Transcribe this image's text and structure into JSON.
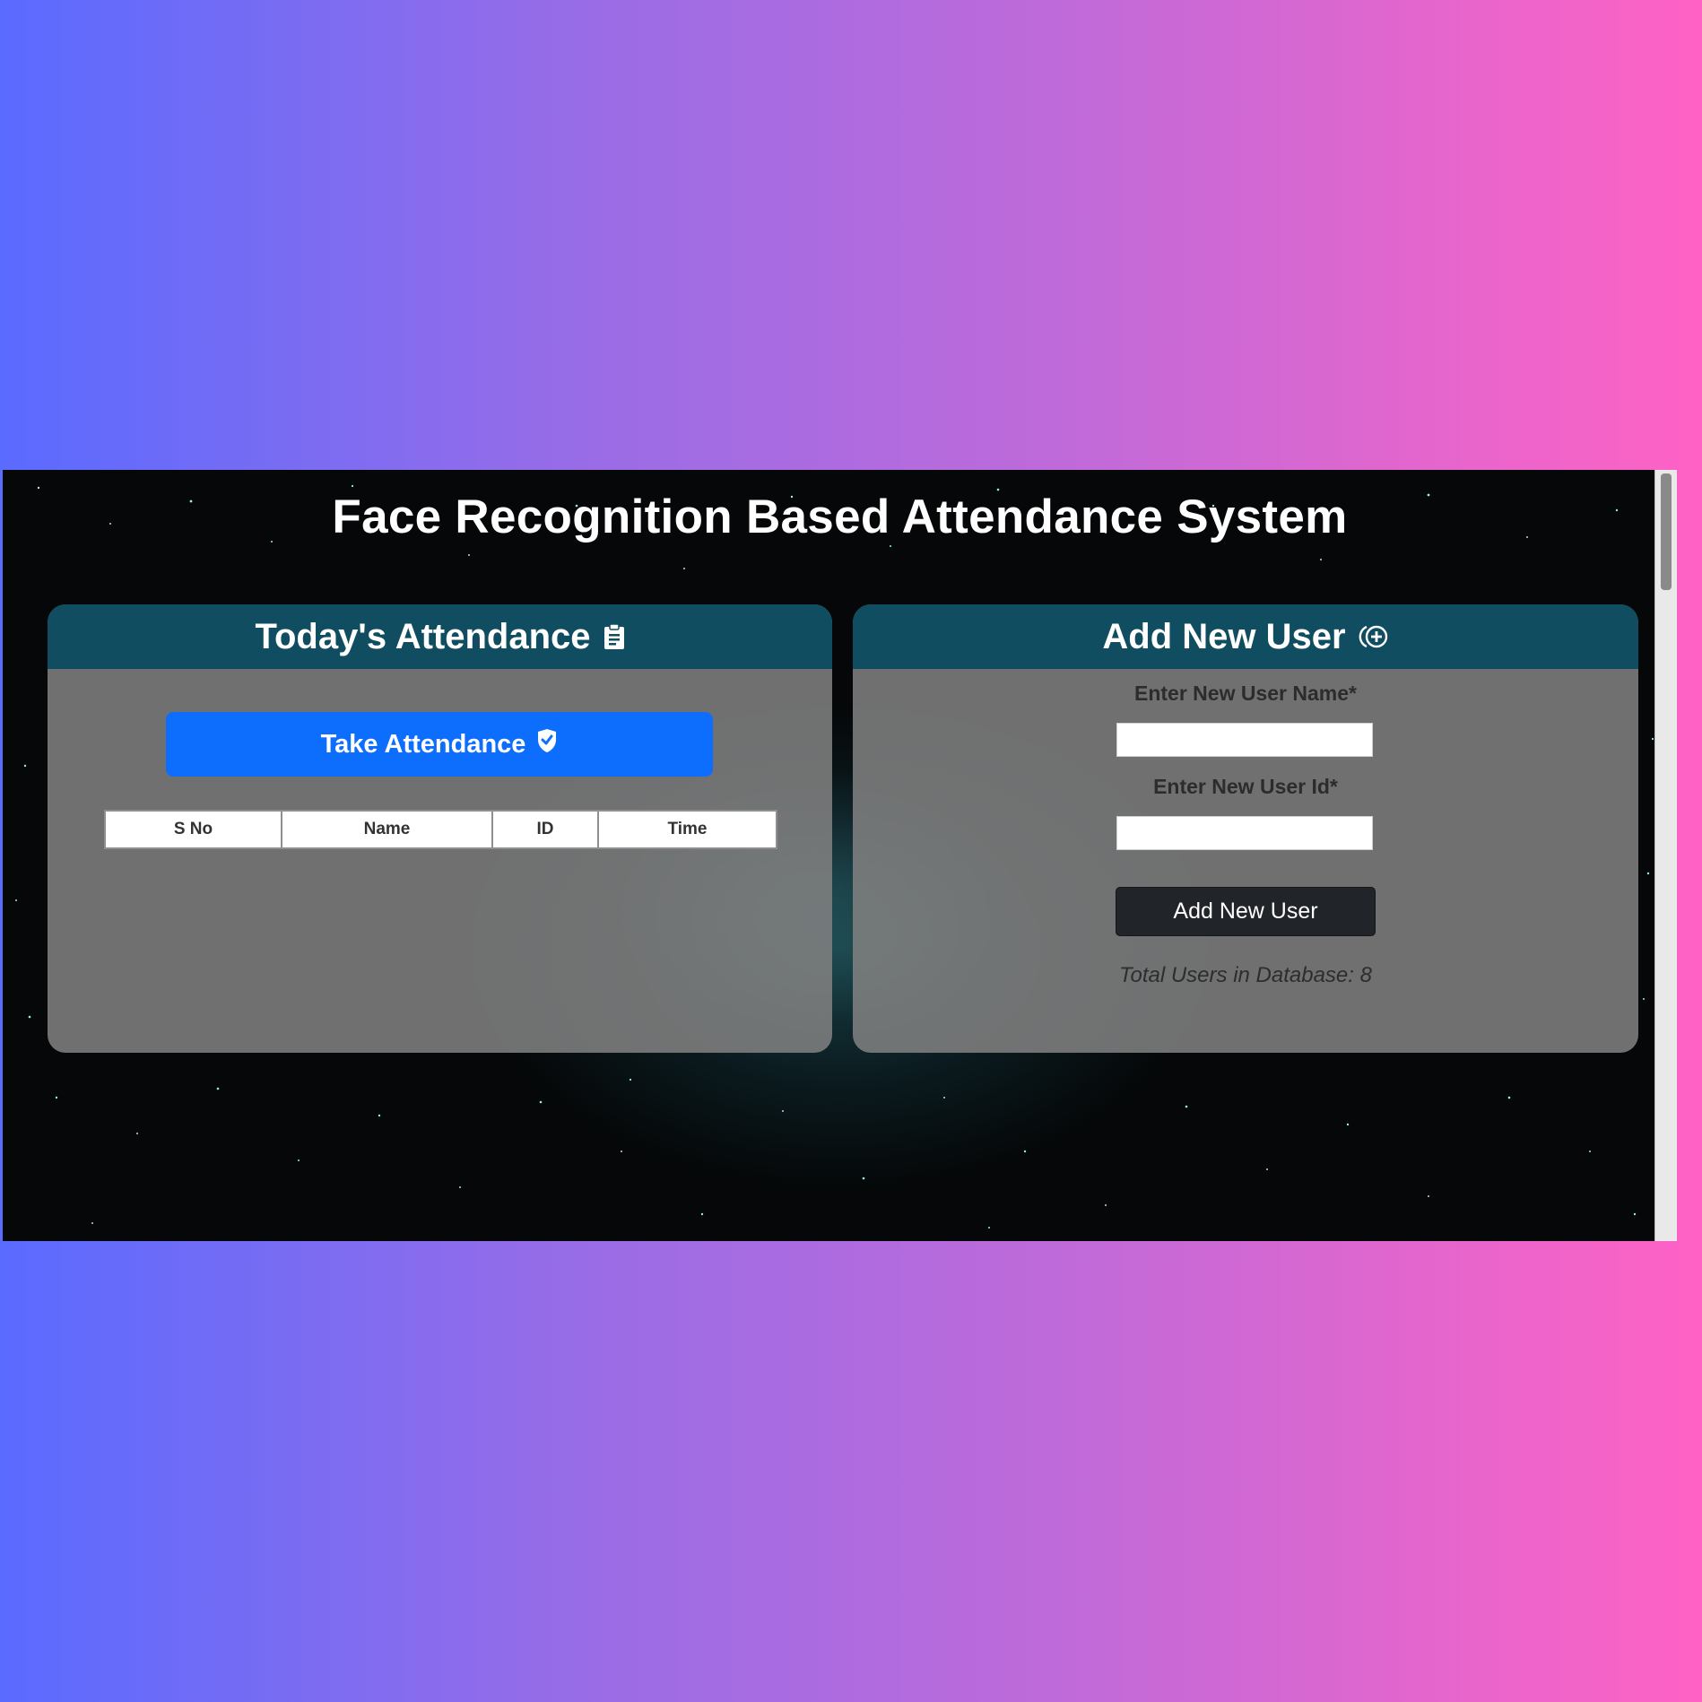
{
  "app": {
    "title": "Face Recognition Based Attendance System"
  },
  "attendance_panel": {
    "title": "Today's Attendance",
    "title_icon": "clipboard-icon",
    "take_attendance_label": "Take Attendance",
    "take_attendance_icon": "shield-check-icon",
    "table": {
      "columns": [
        "S No",
        "Name",
        "ID",
        "Time"
      ],
      "rows": []
    }
  },
  "add_user_panel": {
    "title": "Add New User",
    "title_icon": "add-user-icon",
    "name_label": "Enter New User Name*",
    "name_value": "",
    "id_label": "Enter New User Id*",
    "id_value": "",
    "add_button_label": "Add New User",
    "total_users_text": "Total Users in Database: 8"
  },
  "colors": {
    "header_bg": "#104d60",
    "primary_button": "#0d6efd",
    "dark_button": "#212529",
    "card_bg": "#808080"
  }
}
